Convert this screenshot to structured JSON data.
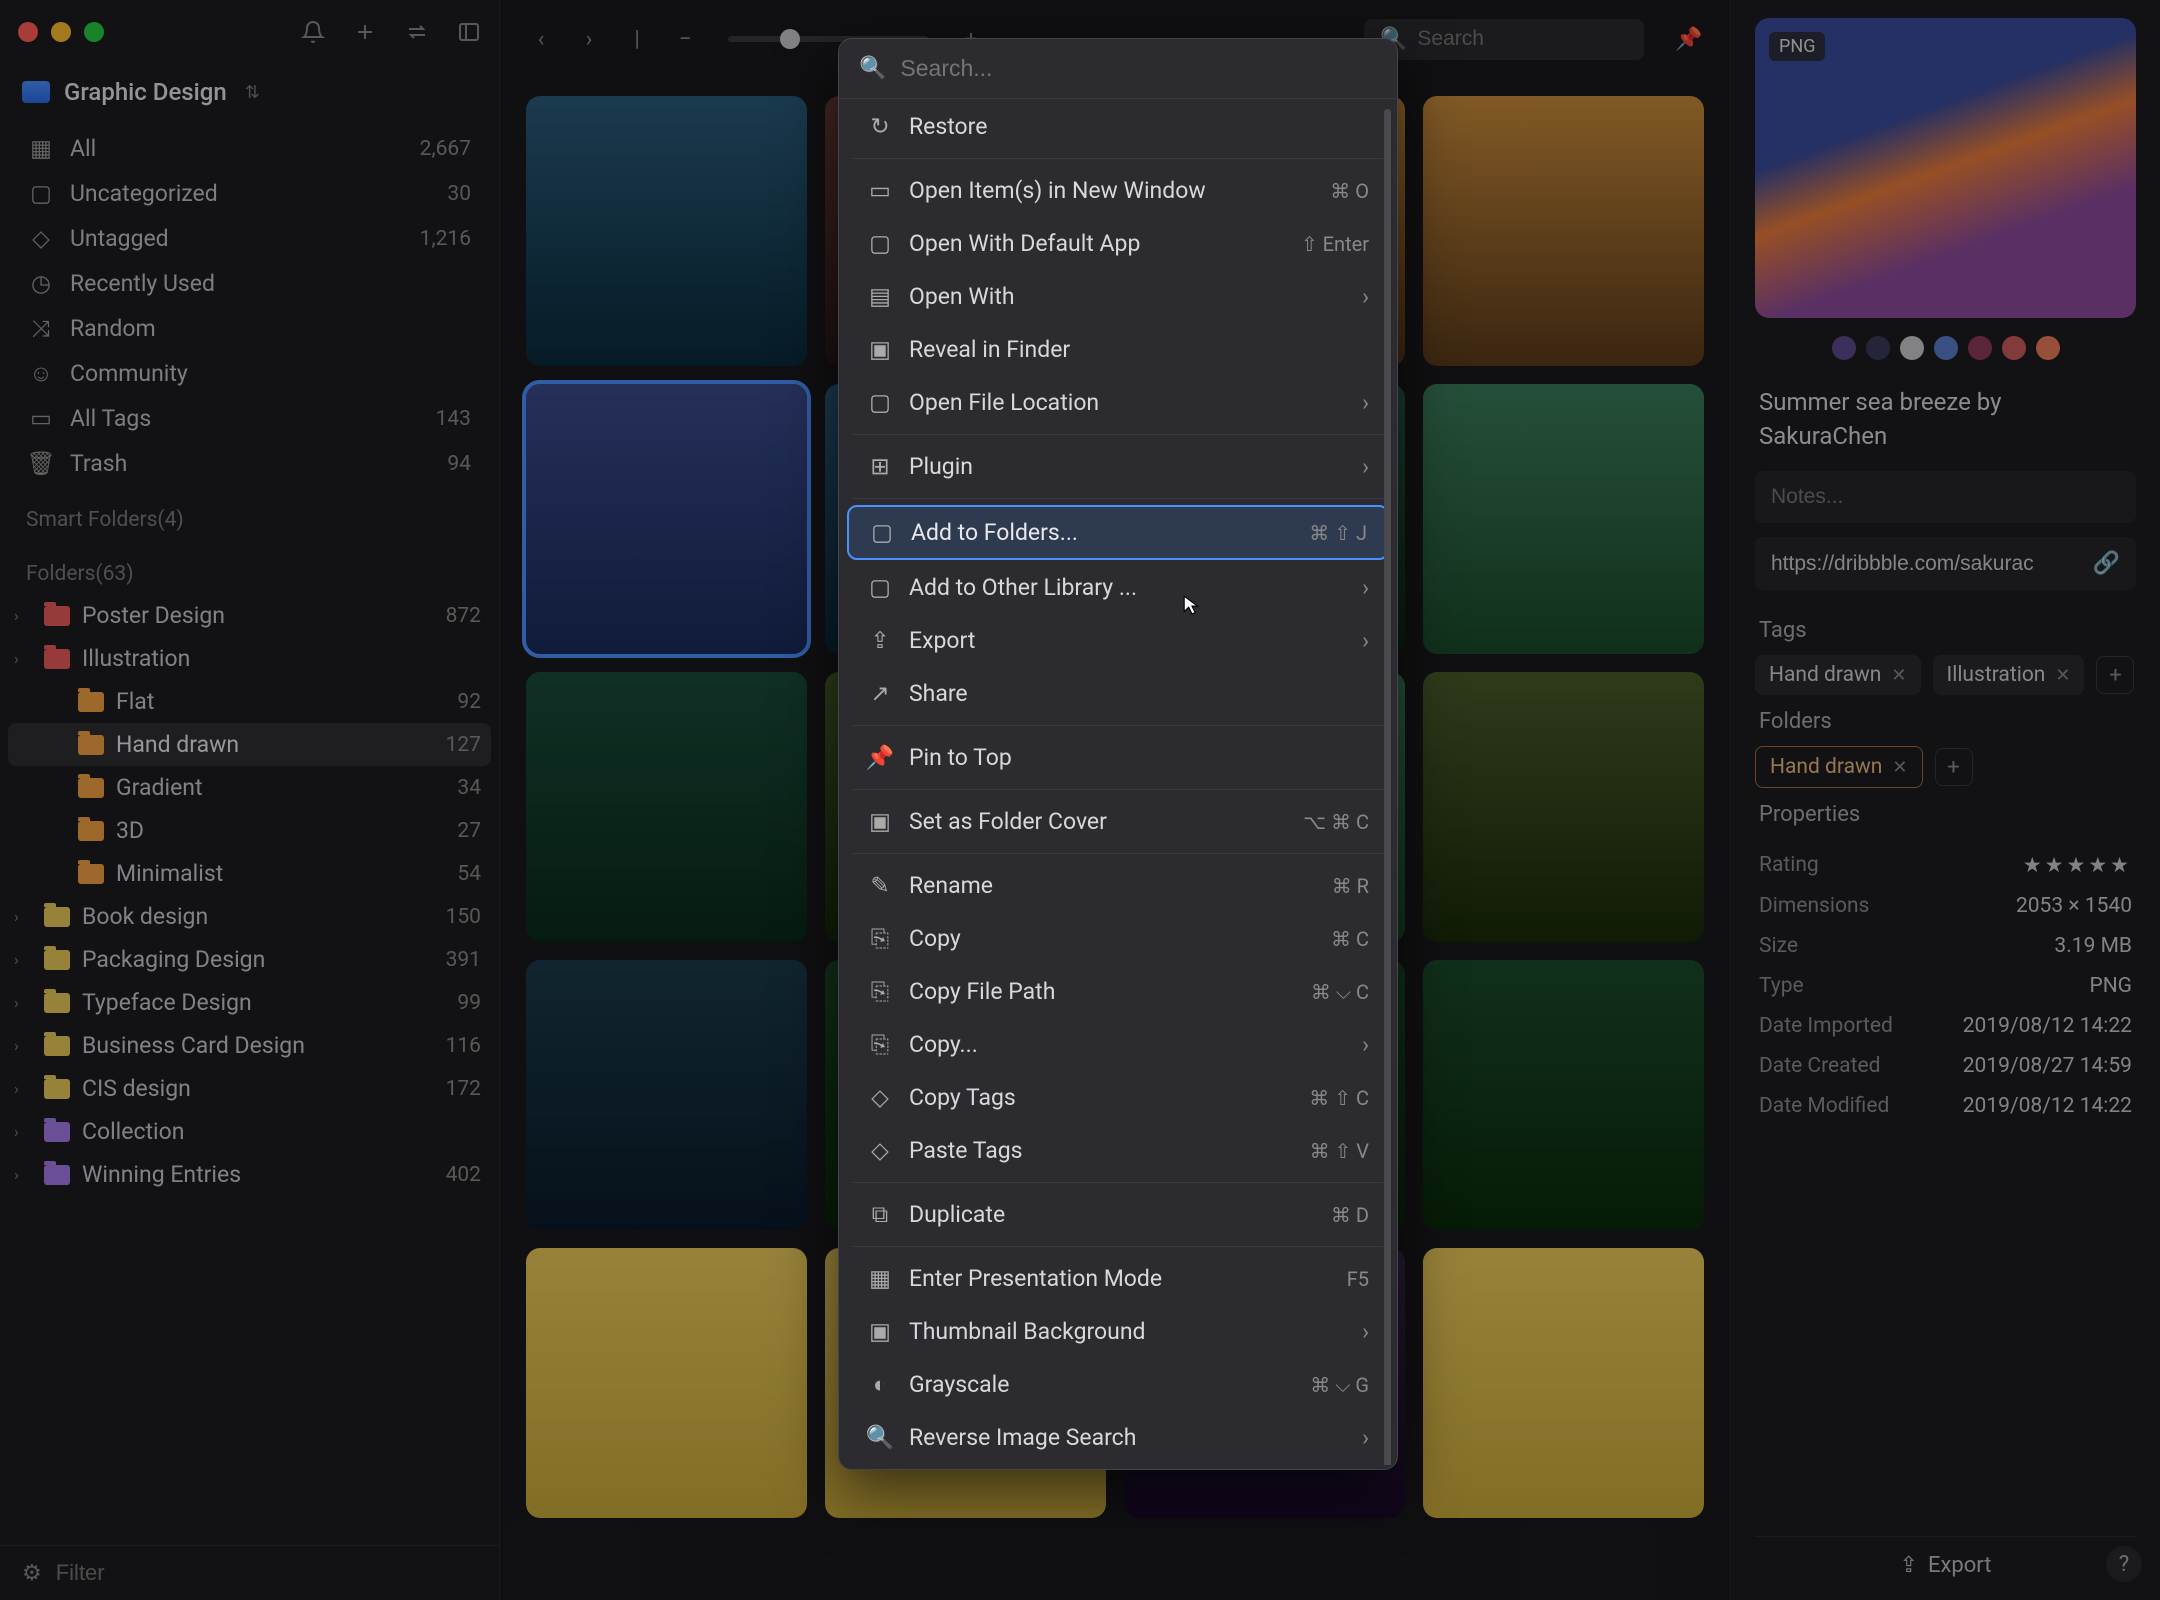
{
  "library": {
    "name": "Graphic Design"
  },
  "nav": {
    "all": {
      "label": "All",
      "count": "2,667"
    },
    "uncat": {
      "label": "Uncategorized",
      "count": "30"
    },
    "untag": {
      "label": "Untagged",
      "count": "1,216"
    },
    "recent": {
      "label": "Recently Used"
    },
    "random": {
      "label": "Random"
    },
    "community": {
      "label": "Community"
    },
    "alltags": {
      "label": "All Tags",
      "count": "143"
    },
    "trash": {
      "label": "Trash",
      "count": "94"
    }
  },
  "sections": {
    "smart": "Smart Folders(4)",
    "folders": "Folders(63)"
  },
  "folders": [
    {
      "name": "Poster Design",
      "count": "872",
      "color": "f-red"
    },
    {
      "name": "Illustration",
      "count": "",
      "color": "f-red",
      "open": true
    },
    {
      "name": "Flat",
      "count": "92",
      "color": "f-orange",
      "indent": 1
    },
    {
      "name": "Hand drawn",
      "count": "127",
      "color": "f-orange",
      "indent": 1,
      "active": true
    },
    {
      "name": "Gradient",
      "count": "34",
      "color": "f-orange",
      "indent": 1
    },
    {
      "name": "3D",
      "count": "27",
      "color": "f-orange",
      "indent": 1
    },
    {
      "name": "Minimalist",
      "count": "54",
      "color": "f-orange",
      "indent": 1
    },
    {
      "name": "Book design",
      "count": "150",
      "color": "f-yellow"
    },
    {
      "name": "Packaging Design",
      "count": "391",
      "color": "f-yellow"
    },
    {
      "name": "Typeface Design",
      "count": "99",
      "color": "f-yellow"
    },
    {
      "name": "Business Card Design",
      "count": "116",
      "color": "f-yellow"
    },
    {
      "name": "CIS design",
      "count": "172",
      "color": "f-yellow"
    },
    {
      "name": "Collection",
      "count": "",
      "color": "f-purple"
    },
    {
      "name": "Winning Entries",
      "count": "402",
      "color": "f-purple"
    }
  ],
  "filter": {
    "placeholder": "Filter"
  },
  "toolbar": {
    "search_placeholder": "Search"
  },
  "inspector": {
    "badge": "PNG",
    "title": "Summer sea breeze by SakuraChen",
    "notes_placeholder": "Notes...",
    "url": "https://dribbble.com/sakurac",
    "tags_label": "Tags",
    "tags": [
      "Hand drawn",
      "Illustration"
    ],
    "folders_label": "Folders",
    "folder_chips": [
      "Hand drawn"
    ],
    "props_label": "Properties",
    "props": {
      "rating_k": "Rating",
      "dim_k": "Dimensions",
      "dim_v": "2053 × 1540",
      "size_k": "Size",
      "size_v": "3.19 MB",
      "type_k": "Type",
      "type_v": "PNG",
      "imp_k": "Date Imported",
      "imp_v": "2019/08/12 14:22",
      "cre_k": "Date Created",
      "cre_v": "2019/08/27 14:59",
      "mod_k": "Date Modified",
      "mod_v": "2019/08/12 14:22"
    },
    "export_label": "Export"
  },
  "context_menu": {
    "search_placeholder": "Search...",
    "items": {
      "restore": "Restore",
      "open_new_window": "Open Item(s) in New Window",
      "open_new_window_sc": "⌘ O",
      "open_default": "Open With Default App",
      "open_default_sc": "⇧ Enter",
      "open_with": "Open With",
      "reveal": "Reveal in Finder",
      "open_loc": "Open File Location",
      "plugin": "Plugin",
      "add_folders": "Add to Folders...",
      "add_folders_sc": "⌘ ⇧ J",
      "add_lib": "Add to Other Library ...",
      "export": "Export",
      "share": "Share",
      "pin": "Pin to Top",
      "cover": "Set as Folder Cover",
      "cover_sc": "⌥ ⌘ C",
      "rename": "Rename",
      "rename_sc": "⌘ R",
      "copy": "Copy",
      "copy_sc": "⌘ C",
      "copy_path": "Copy File Path",
      "copy_path_sc": "⌘ ⌵ C",
      "copy_as": "Copy...",
      "copy_tags": "Copy Tags",
      "copy_tags_sc": "⌘ ⇧ C",
      "paste_tags": "Paste Tags",
      "paste_tags_sc": "⌘ ⇧ V",
      "duplicate": "Duplicate",
      "duplicate_sc": "⌘ D",
      "presentation": "Enter Presentation Mode",
      "presentation_sc": "F5",
      "thumb_bg": "Thumbnail Background",
      "grayscale": "Grayscale",
      "grayscale_sc": "⌘ ⌵ G",
      "reverse": "Reverse Image Search"
    }
  }
}
